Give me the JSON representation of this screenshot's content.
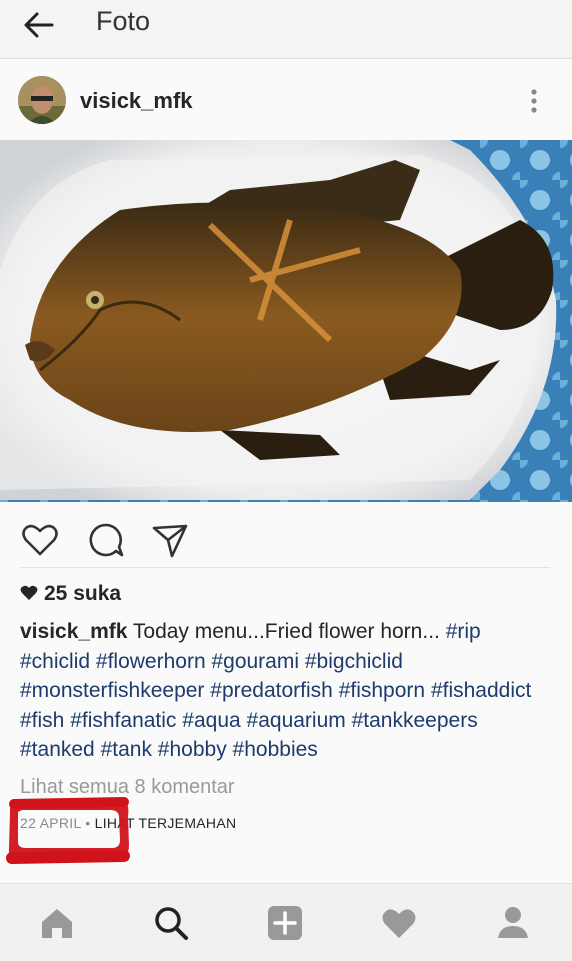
{
  "header": {
    "title": "Foto",
    "back_icon": "back-arrow-icon"
  },
  "post": {
    "username": "visick_mfk",
    "likes": "25 suka",
    "caption": {
      "username": "visick_mfk",
      "text": "Today menu...Fried flower horn...",
      "tags": [
        "#rip",
        "#chiclid",
        "#flowerhorn",
        "#gourami",
        "#bigchiclid",
        "#monsterfishkeeper",
        "#predatorfish",
        "#fishporn",
        "#fishaddict",
        "#fish",
        "#fishfanatic",
        "#aqua",
        "#aquarium",
        "#tankkeepers",
        "#tanked",
        "#tank",
        "#hobby",
        "#hobbies"
      ]
    },
    "comments_link": "Lihat semua 8 komentar",
    "date": "22 APRIL",
    "separator": "•",
    "translate": "LIHAT TERJEMAHAN"
  },
  "actions": [
    "like-icon",
    "comment-icon",
    "share-icon"
  ],
  "bottom_nav": [
    "home-icon",
    "search-icon",
    "add-icon",
    "activity-icon",
    "profile-icon"
  ],
  "colors": {
    "hashtag": "#1e3b6b",
    "annotation": "#d0131b",
    "text": "#262626"
  }
}
